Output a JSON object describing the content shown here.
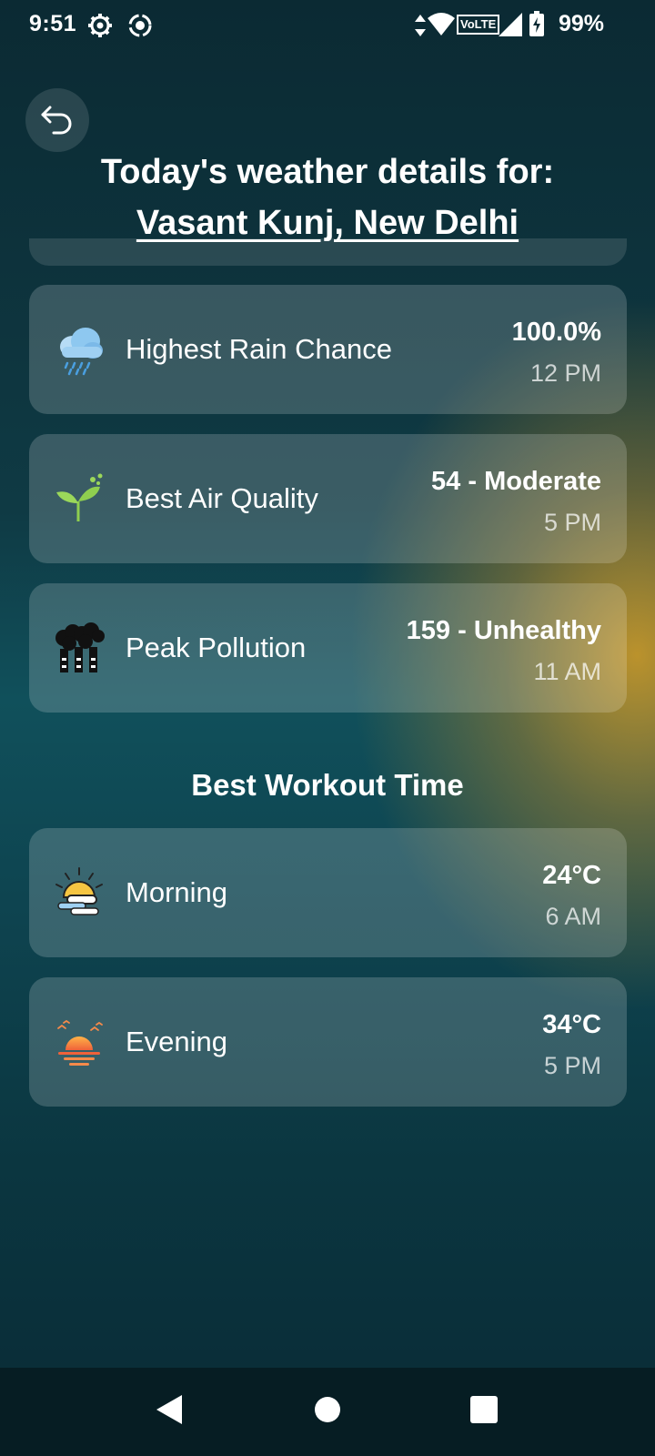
{
  "status_bar": {
    "time": "9:51",
    "battery": "99%",
    "network_label": "VoLTE"
  },
  "header": {
    "back_icon": "undo-arrow-icon",
    "title": "Today's weather details for:",
    "location": "Vasant Kunj, New Delhi"
  },
  "details": [
    {
      "icon": "rain-cloud-icon",
      "label": "Highest Rain Chance",
      "value": "100.0%",
      "time": "12 PM"
    },
    {
      "icon": "sprout-icon",
      "label": "Best Air Quality",
      "value": "54 - Moderate",
      "time": "5 PM"
    },
    {
      "icon": "factory-smoke-icon",
      "label": "Peak Pollution",
      "value": "159 - Unhealthy",
      "time": "11 AM"
    }
  ],
  "workout": {
    "heading": "Best Workout Time",
    "items": [
      {
        "icon": "sunrise-cloud-icon",
        "label": "Morning",
        "value": "24°C",
        "time": "6 AM"
      },
      {
        "icon": "sunset-icon",
        "label": "Evening",
        "value": "34°C",
        "time": "5 PM"
      }
    ]
  },
  "colors": {
    "accent_glow": "#c4962a",
    "background_dark": "#0b2a33"
  }
}
